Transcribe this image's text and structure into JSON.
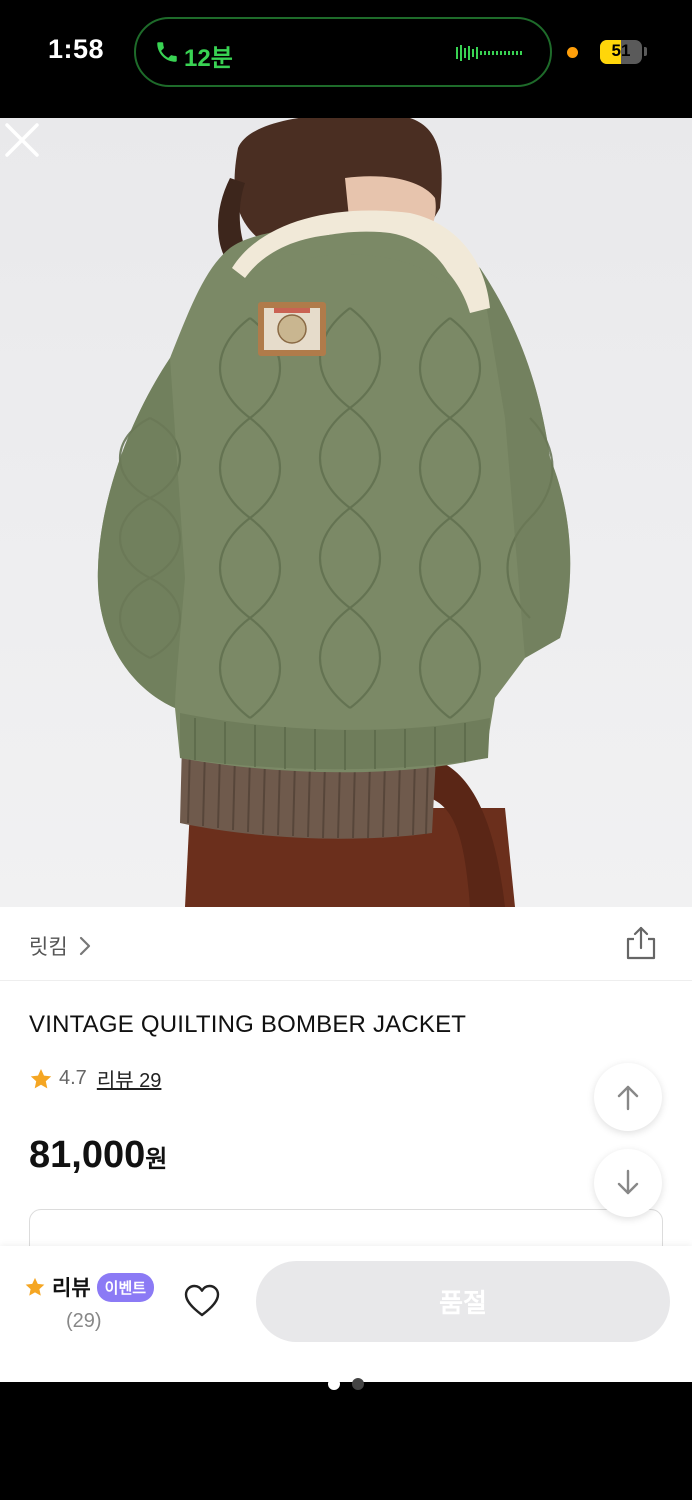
{
  "status_bar": {
    "time": "1:58",
    "call_duration": "12분",
    "battery_level": "51",
    "battery_fraction": 0.51
  },
  "product": {
    "brand": "릿킴",
    "title": "VINTAGE QUILTING BOMBER JACKET",
    "rating": "4.7",
    "review_link": "리뷰 29",
    "price": "81,000",
    "price_unit": "원"
  },
  "bottom_bar": {
    "review_label": "리뷰",
    "event_badge": "이벤트",
    "review_count": "(29)",
    "purchase_button": "품절"
  },
  "colors": {
    "accent_star": "#f5a623",
    "event_badge": "#8b7af5",
    "call_green": "#39d353",
    "battery": "#ffd60a"
  },
  "icons": [
    "phone-icon",
    "close-icon",
    "chevron-right-icon",
    "share-icon",
    "star-icon",
    "arrow-up-icon",
    "arrow-down-icon",
    "heart-icon"
  ]
}
